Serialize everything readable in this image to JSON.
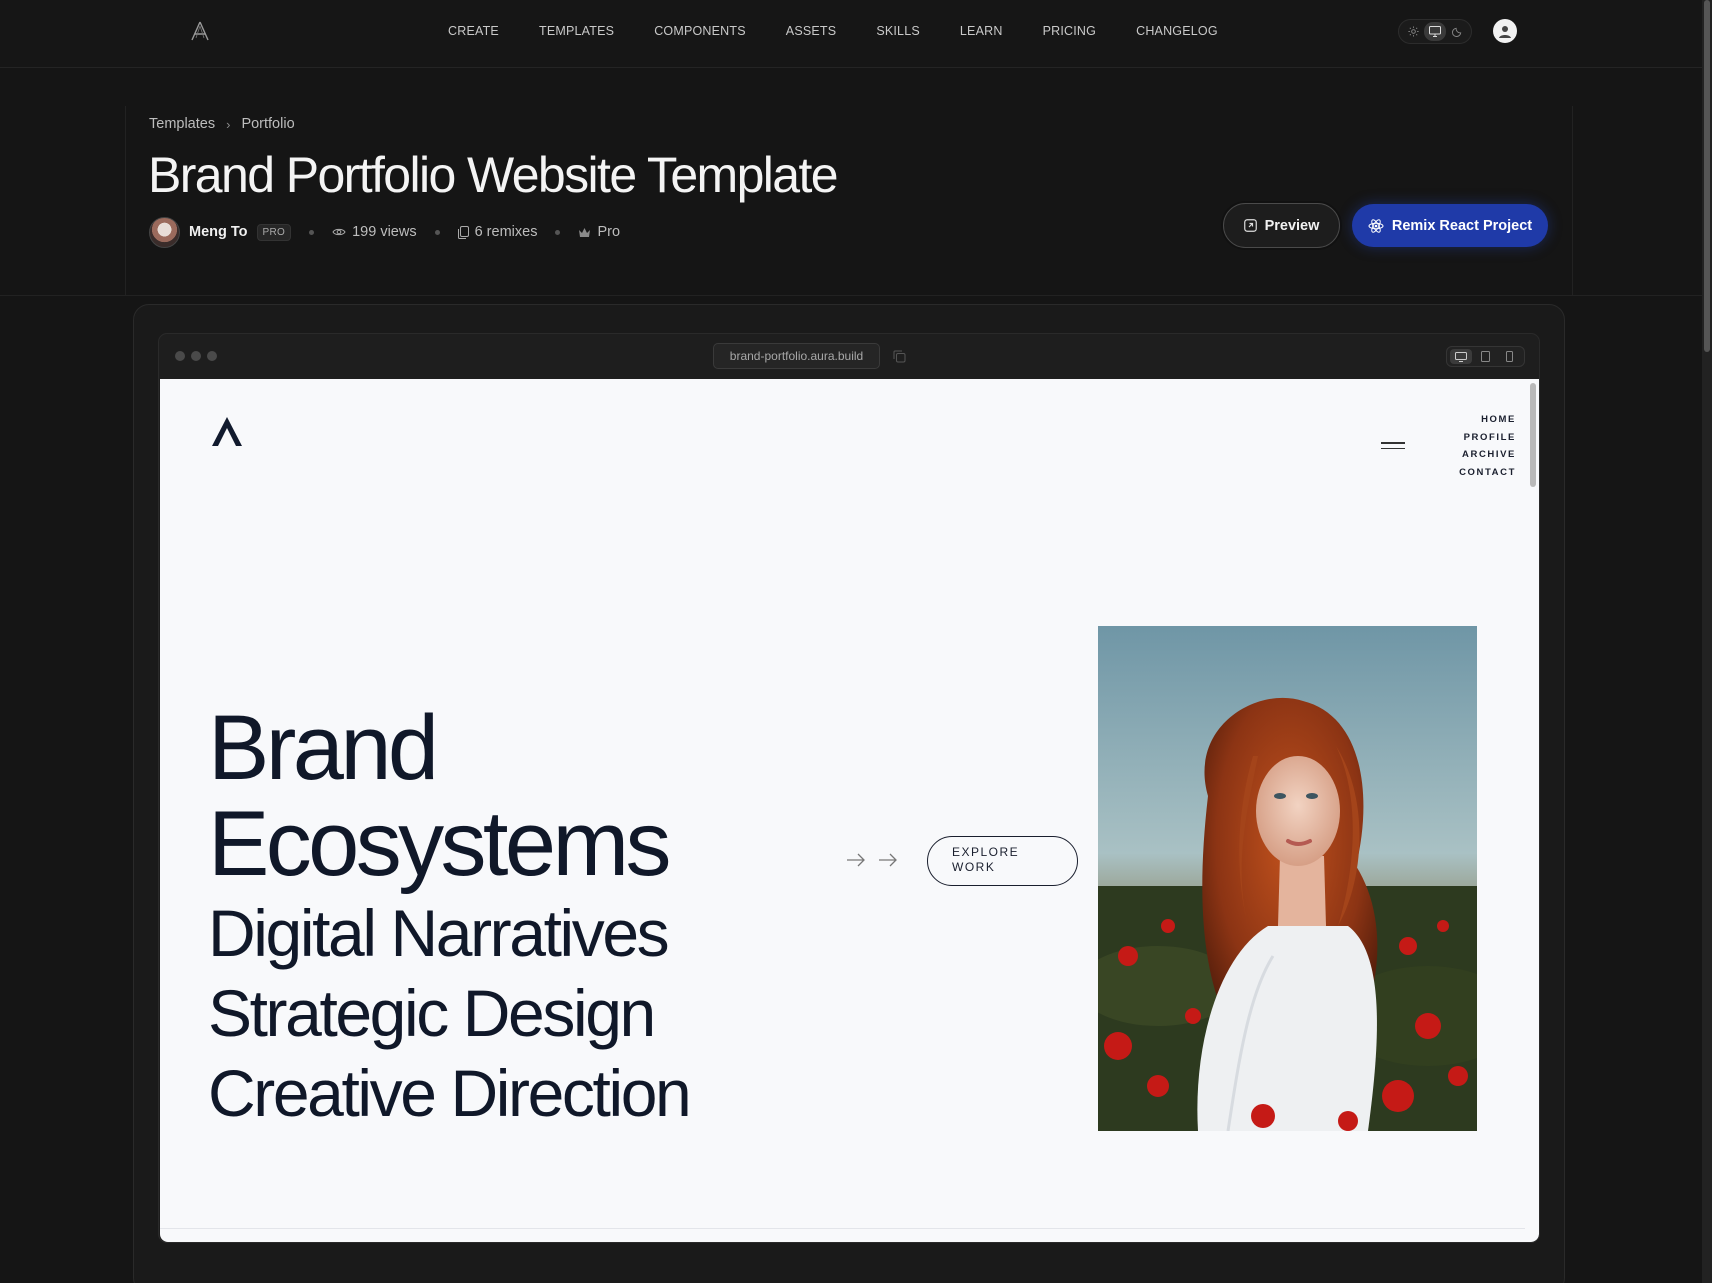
{
  "topnav": {
    "links": [
      "CREATE",
      "TEMPLATES",
      "COMPONENTS",
      "ASSETS",
      "SKILLS",
      "LEARN",
      "PRICING",
      "CHANGELOG"
    ]
  },
  "breadcrumb": {
    "items": [
      "Templates",
      "Portfolio"
    ]
  },
  "page": {
    "title": "Brand Portfolio Website Template",
    "author": "Meng To",
    "author_badge": "PRO",
    "views": "199 views",
    "remixes": "6 remixes",
    "tier": "Pro"
  },
  "actions": {
    "preview_label": "Preview",
    "remix_label": "Remix React Project",
    "remix_color": "#1f3aa8"
  },
  "browser": {
    "url": "brand-portfolio.aura.build"
  },
  "site": {
    "menu": [
      "HOME",
      "PROFILE",
      "ARCHIVE",
      "CONTACT"
    ],
    "hero": [
      "Brand",
      "Ecosystems",
      "Digital Narratives",
      "Strategic Design",
      "Creative Direction"
    ],
    "cta_line1": "EXPLORE",
    "cta_line2": "WORK",
    "text_color": "#101829"
  }
}
